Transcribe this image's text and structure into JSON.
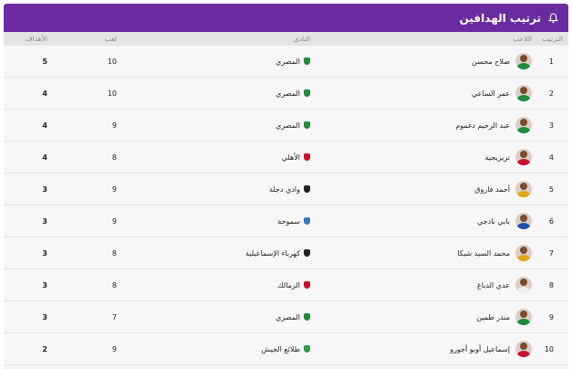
{
  "header": {
    "title": "ترتيب الهدافين",
    "icon": "bell-icon"
  },
  "columns": {
    "rank": "الترتيب",
    "player": "اللاعب",
    "club": "النادي",
    "played": "لعب",
    "goals": "الأهداف"
  },
  "rows": [
    {
      "rank": "1",
      "player": "صلاح محسن",
      "club": "المصري",
      "played": "10",
      "goals": "5",
      "shirt": "#1e8a3c",
      "logo": "#1e8a3c"
    },
    {
      "rank": "2",
      "player": "عمر الساعي",
      "club": "المصري",
      "played": "10",
      "goals": "4",
      "shirt": "#1e8a3c",
      "logo": "#1e8a3c"
    },
    {
      "rank": "3",
      "player": "عبد الرحيم دغموم",
      "club": "المصري",
      "played": "9",
      "goals": "4",
      "shirt": "#1e8a3c",
      "logo": "#1e8a3c"
    },
    {
      "rank": "4",
      "player": "تريزيجيه",
      "club": "الأهلي",
      "played": "8",
      "goals": "4",
      "shirt": "#c8102e",
      "logo": "#c8102e"
    },
    {
      "rank": "5",
      "player": "أحمد فاروق",
      "club": "وادي دجلة",
      "played": "9",
      "goals": "3",
      "shirt": "#e0a81a",
      "logo": "#222222"
    },
    {
      "rank": "6",
      "player": "بابي بادجي",
      "club": "سموحة",
      "played": "9",
      "goals": "3",
      "shirt": "#1f4fa8",
      "logo": "#3a78c4"
    },
    {
      "rank": "7",
      "player": "محمد السيد شيكا",
      "club": "كهرباء الإسماعيلية",
      "played": "8",
      "goals": "3",
      "shirt": "#e0a81a",
      "logo": "#222222"
    },
    {
      "rank": "8",
      "player": "عدي الدباغ",
      "club": "الزمالك",
      "played": "8",
      "goals": "3",
      "shirt": "#eeeeee",
      "logo": "#c8102e"
    },
    {
      "rank": "9",
      "player": "منذر طمين",
      "club": "المصري",
      "played": "7",
      "goals": "3",
      "shirt": "#1e8a3c",
      "logo": "#1e8a3c"
    },
    {
      "rank": "10",
      "player": "إسماعيل أوبو أجورو",
      "club": "طلائع الجيش",
      "played": "9",
      "goals": "2",
      "shirt": "#c8102e",
      "logo": "#2f9a4a"
    }
  ]
}
